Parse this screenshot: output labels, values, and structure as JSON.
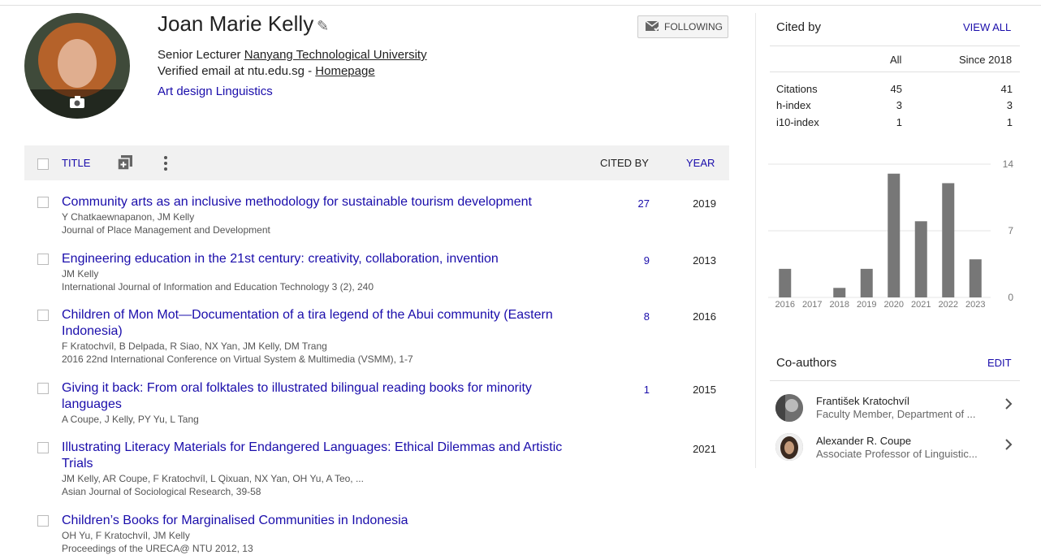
{
  "profile": {
    "name": "Joan Marie Kelly",
    "position": "Senior Lecturer",
    "university": "Nanyang Technological University",
    "email_text": "Verified email at ntu.edu.sg - ",
    "homepage": "Homepage",
    "interests": [
      "Art design",
      "Linguistics"
    ],
    "follow_label": "FOLLOWING"
  },
  "table": {
    "title_header": "TITLE",
    "cited_header": "CITED BY",
    "year_header": "YEAR"
  },
  "articles": [
    {
      "title": "Community arts as an inclusive methodology for sustainable tourism development",
      "authors": "Y Chatkaewnapanon, JM Kelly",
      "venue": "Journal of Place Management and Development",
      "cited": "27",
      "year": "2019"
    },
    {
      "title": "Engineering education in the 21st century: creativity, collaboration, invention",
      "authors": "JM Kelly",
      "venue": "International Journal of Information and Education Technology 3 (2), 240",
      "cited": "9",
      "year": "2013"
    },
    {
      "title": "Children of Mon Mot—Documentation of a tira legend of the Abui community (Eastern Indonesia)",
      "authors": "F Kratochvíl, B Delpada, R Siao, NX Yan, JM Kelly, DM Trang",
      "venue": "2016 22nd International Conference on Virtual System & Multimedia (VSMM), 1-7",
      "cited": "8",
      "year": "2016"
    },
    {
      "title": "Giving it back: From oral folktales to illustrated bilingual reading books for minority languages",
      "authors": "A Coupe, J Kelly, PY Yu, L Tang",
      "venue": "",
      "cited": "1",
      "year": "2015"
    },
    {
      "title": "Illustrating Literacy Materials for Endangered Languages: Ethical Dilemmas and Artistic Trials",
      "authors": "JM Kelly, AR Coupe, F Kratochvíl, L Qixuan, NX Yan, OH Yu, A Teo, ...",
      "venue": "Asian Journal of Sociological Research, 39-58",
      "cited": "",
      "year": "2021"
    },
    {
      "title": "Children’s Books for Marginalised Communities in Indonesia",
      "authors": "OH Yu, F Kratochvíl, JM Kelly",
      "venue": "Proceedings of the URECA@ NTU 2012, 13",
      "cited": "",
      "year": ""
    }
  ],
  "cited_by": {
    "title": "Cited by",
    "view_all": "VIEW ALL",
    "col_all": "All",
    "col_since": "Since 2018",
    "rows": [
      {
        "label": "Citations",
        "all": "45",
        "since": "41"
      },
      {
        "label": "h-index",
        "all": "3",
        "since": "3"
      },
      {
        "label": "i10-index",
        "all": "1",
        "since": "1"
      }
    ]
  },
  "chart_data": {
    "type": "bar",
    "categories": [
      "2016",
      "2017",
      "2018",
      "2019",
      "2020",
      "2021",
      "2022",
      "2023"
    ],
    "values": [
      3,
      0,
      1,
      3,
      13,
      8,
      12,
      4
    ],
    "ylim": [
      0,
      14
    ],
    "yticks": [
      "14",
      "7",
      "0"
    ],
    "bar_color": "#777777",
    "grid": true
  },
  "coauthors": {
    "title": "Co-authors",
    "edit": "EDIT",
    "list": [
      {
        "name": "František Kratochvíl",
        "affiliation": "Faculty Member, Department of ..."
      },
      {
        "name": "Alexander R. Coupe",
        "affiliation": "Associate Professor of Linguistic..."
      }
    ]
  }
}
